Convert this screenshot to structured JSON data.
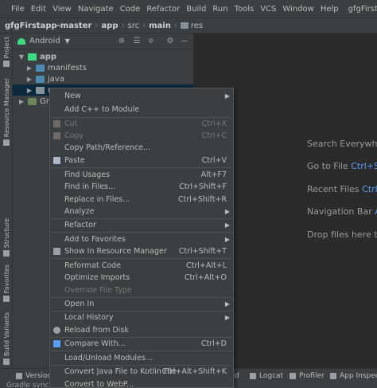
{
  "menubar": {
    "items": [
      "File",
      "Edit",
      "View",
      "Navigate",
      "Code",
      "Refactor",
      "Build",
      "Run",
      "Tools",
      "VCS",
      "Window",
      "Help"
    ],
    "project_title": "gfgFirstapp"
  },
  "navbar": {
    "crumbs": [
      "gfgFirstapp-master",
      "app",
      "src",
      "main",
      "res"
    ]
  },
  "left_strip": {
    "tabs": [
      "Project",
      "Resource Manager",
      "Structure",
      "Favorites",
      "Build Variants"
    ]
  },
  "project_panel": {
    "view_label": "Android",
    "tree": [
      {
        "label": "app",
        "bold": true
      },
      {
        "label": "manifests"
      },
      {
        "label": "java"
      },
      {
        "label": "r"
      },
      {
        "label": "Gr"
      }
    ]
  },
  "editor_hints": {
    "search_everywhere": "Search Everywhe",
    "go_to_file": "Go to File",
    "go_to_file_key": "Ctrl+S",
    "recent_files": "Recent Files",
    "recent_files_key": "Ctrl",
    "navigation_bar": "Navigation Bar",
    "navigation_bar_key": "A",
    "drop_files": "Drop files here to"
  },
  "bottom_bar": {
    "tabs": [
      "Version",
      "ild",
      "Logcat",
      "Profiler",
      "App Inspecti"
    ],
    "bottom_left": "Gradle sync"
  },
  "context_menu": {
    "items": [
      {
        "label": "New",
        "shortcut": "",
        "submenu": true
      },
      {
        "label": "Add C++ to Module",
        "shortcut": ""
      },
      {
        "label": "Cut",
        "shortcut": "Ctrl+X",
        "disabled": true
      },
      {
        "label": "Copy",
        "shortcut": "Ctrl+C",
        "disabled": true
      },
      {
        "label": "Copy Path/Reference...",
        "shortcut": ""
      },
      {
        "label": "Paste",
        "shortcut": "Ctrl+V"
      },
      {
        "label": "Find Usages",
        "shortcut": "Alt+F7"
      },
      {
        "label": "Find in Files...",
        "shortcut": "Ctrl+Shift+F"
      },
      {
        "label": "Replace in Files...",
        "shortcut": "Ctrl+Shift+R"
      },
      {
        "label": "Analyze",
        "shortcut": "",
        "submenu": true
      },
      {
        "label": "Refactor",
        "shortcut": "",
        "submenu": true
      },
      {
        "label": "Add to Favorites",
        "shortcut": "",
        "submenu": true
      },
      {
        "label": "Show In Resource Manager",
        "shortcut": "Ctrl+Shift+T"
      },
      {
        "label": "Reformat Code",
        "shortcut": "Ctrl+Alt+L"
      },
      {
        "label": "Optimize Imports",
        "shortcut": "Ctrl+Alt+O"
      },
      {
        "label": "Override File Type",
        "shortcut": "",
        "disabled": true
      },
      {
        "label": "Open In",
        "shortcut": "",
        "submenu": true
      },
      {
        "label": "Local History",
        "shortcut": "",
        "submenu": true
      },
      {
        "label": "Reload from Disk",
        "shortcut": ""
      },
      {
        "label": "Compare With...",
        "shortcut": "Ctrl+D"
      },
      {
        "label": "Load/Unload Modules...",
        "shortcut": ""
      },
      {
        "label": "Convert Java File to Kotlin File",
        "shortcut": "Ctrl+Alt+Shift+K"
      },
      {
        "label": "Convert to WebP...",
        "shortcut": ""
      }
    ]
  },
  "colors": {
    "background": "#2b2b2b",
    "panel": "#3c3f41",
    "selection": "#0d293e",
    "accent_blue": "#589df6",
    "android_green": "#3ddc84"
  }
}
